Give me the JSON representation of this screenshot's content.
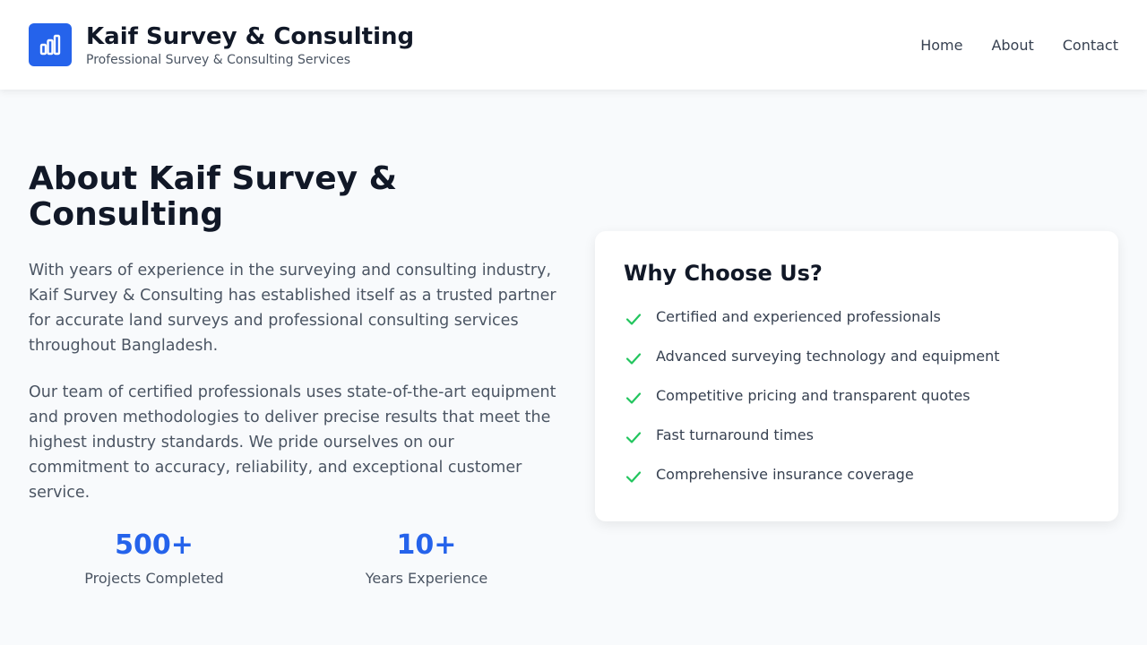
{
  "header": {
    "logo_icon": "bar-chart-icon",
    "brand_name": "Kaif Survey & Consulting",
    "tagline": "Professional Survey & Consulting Services",
    "nav": [
      {
        "label": "Home"
      },
      {
        "label": "About"
      },
      {
        "label": "Contact"
      }
    ]
  },
  "about": {
    "title": "About Kaif Survey & Consulting",
    "paragraphs": [
      "With years of experience in the surveying and consulting industry, Kaif Survey & Consulting has established itself as a trusted partner for accurate land surveys and professional consulting services throughout Bangladesh.",
      "Our team of certified professionals uses state-of-the-art equipment and proven methodologies to deliver precise results that meet the highest industry standards. We pride ourselves on our commitment to accuracy, reliability, and exceptional customer service."
    ],
    "stats": [
      {
        "value": "500+",
        "label": "Projects Completed"
      },
      {
        "value": "10+",
        "label": "Years Experience"
      }
    ]
  },
  "why": {
    "title": "Why Choose Us?",
    "check_icon": "check-icon",
    "items": [
      "Certified and experienced professionals",
      "Advanced surveying technology and equipment",
      "Competitive pricing and transparent quotes",
      "Fast turnaround times",
      "Comprehensive insurance coverage"
    ]
  },
  "colors": {
    "accent": "#2563eb",
    "check": "#22c55e",
    "background": "#f8fafc",
    "text_dark": "#111827",
    "text_muted": "#4b5563"
  }
}
